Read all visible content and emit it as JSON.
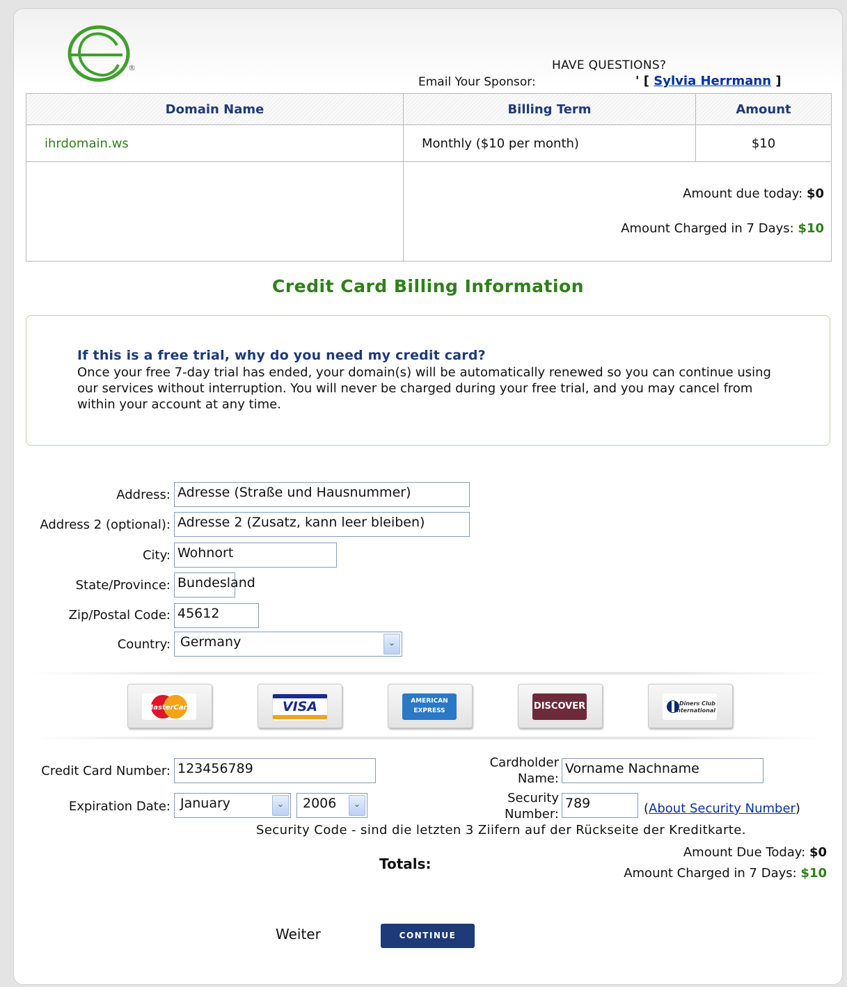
{
  "header": {
    "have_questions": "HAVE QUESTIONS?",
    "email_sponsor_label": "Email Your Sponsor:",
    "sponsor_bullet": "' [",
    "sponsor_name": "Sylvia Herrmann",
    "sponsor_close": "]",
    "logo_icon": "globe-logo-icon",
    "registered": "®"
  },
  "order_table": {
    "headers": [
      "Domain Name",
      "Billing Term",
      "Amount"
    ],
    "row": {
      "domain": "ihrdomain.ws",
      "term": "Monthly ($10 per month)",
      "amount": "$10"
    },
    "due_today_label": "Amount due today:",
    "due_today_value": "$0",
    "charged_label": "Amount Charged in 7 Days:",
    "charged_value": "$10"
  },
  "section_title": "Credit Card Billing Information",
  "info_box": {
    "question": "If this is a free trial, why do you need my credit card?",
    "text": "Once your free 7-day trial has ended, your domain(s) will be automatically renewed so you can continue using our services without interruption. You will never be charged during your free trial, and you may cancel from within your account at any time."
  },
  "address_form": {
    "address_label": "Address:",
    "address_value": "Adresse (Straße und Hausnummer)",
    "address2_label": "Address 2 (optional):",
    "address2_value": "Adresse 2 (Zusatz, kann leer bleiben)",
    "city_label": "City:",
    "city_value": "Wohnort",
    "state_label": "State/Province:",
    "state_value": "Bundesland",
    "zip_label": "Zip/Postal Code:",
    "zip_value": "45612",
    "country_label": "Country:",
    "country_value": "Germany"
  },
  "card_types": [
    "MasterCard",
    "VISA",
    "AMERICAN EXPRESS",
    "DISCOVER",
    "Diners Club International"
  ],
  "payment_form": {
    "cc_number_label": "Credit Card Number:",
    "cc_number_value": "123456789",
    "holder_label_1": "Cardholder",
    "holder_label_2": "Name:",
    "holder_value": "Vorname Nachname",
    "exp_label": "Expiration Date:",
    "exp_month": "January",
    "exp_year": "2006",
    "sec_label_1": "Security",
    "sec_label_2": "Number:",
    "sec_value": "789",
    "about_open": "(",
    "about_link": "About Security Number",
    "about_close": ")",
    "sec_note": "Security Code - sind die letzten 3 Ziifern auf der Rückseite der Kreditkarte."
  },
  "totals": {
    "label": "Totals:",
    "due_today_label": "Amount Due Today:",
    "due_today_value": "$0",
    "charged_label": "Amount Charged in 7 Days:",
    "charged_value": "$10"
  },
  "actions": {
    "weiter": "Weiter",
    "continue": "CONTINUE"
  }
}
